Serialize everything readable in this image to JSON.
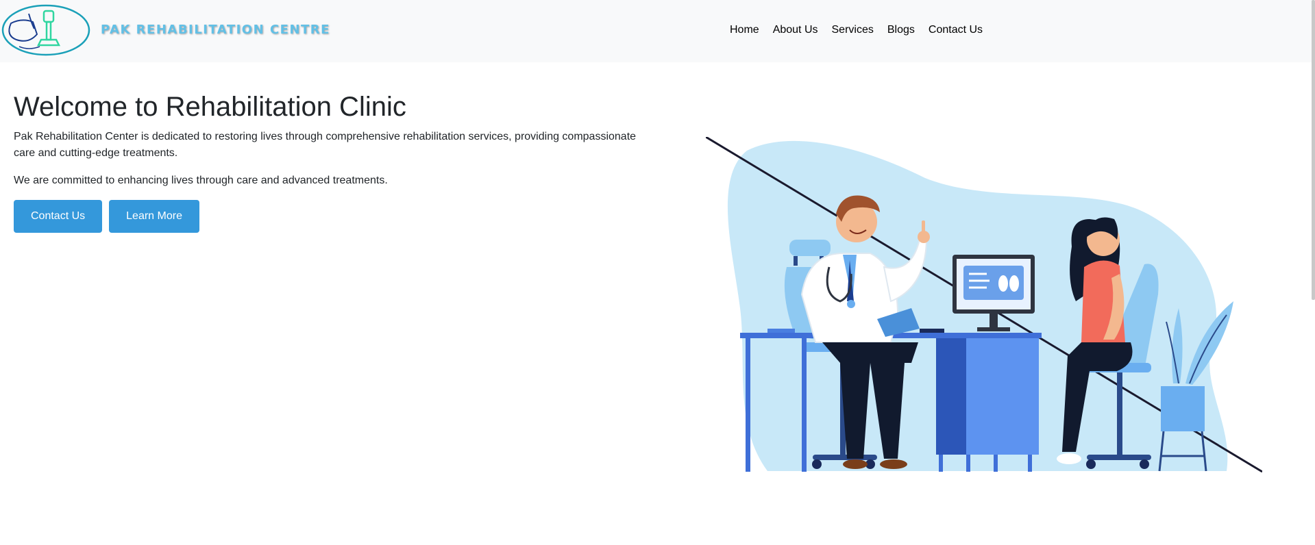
{
  "brand": {
    "name": "PAK REHABILITATION CENTRE",
    "logo_icon": "prosthetic-leg-logo"
  },
  "nav": {
    "items": [
      {
        "label": "Home"
      },
      {
        "label": "About Us"
      },
      {
        "label": "Services"
      },
      {
        "label": "Blogs"
      },
      {
        "label": "Contact Us"
      }
    ]
  },
  "hero": {
    "title": "Welcome to Rehabilitation Clinic",
    "paragraph1": "Pak Rehabilitation Center is dedicated to restoring lives through comprehensive rehabilitation services, providing compassionate care and cutting-edge treatments.",
    "paragraph2": "We are committed to enhancing lives through care and advanced treatments.",
    "primary_button": "Contact Us",
    "secondary_button": "Learn More"
  },
  "illustration": {
    "subject": "doctor-consultation-illustration"
  },
  "colors": {
    "accent": "#3498db",
    "brand_text": "#62c0e6",
    "navbar_bg": "#f8f9fa",
    "illustration_blob": "#c8e8f8"
  }
}
